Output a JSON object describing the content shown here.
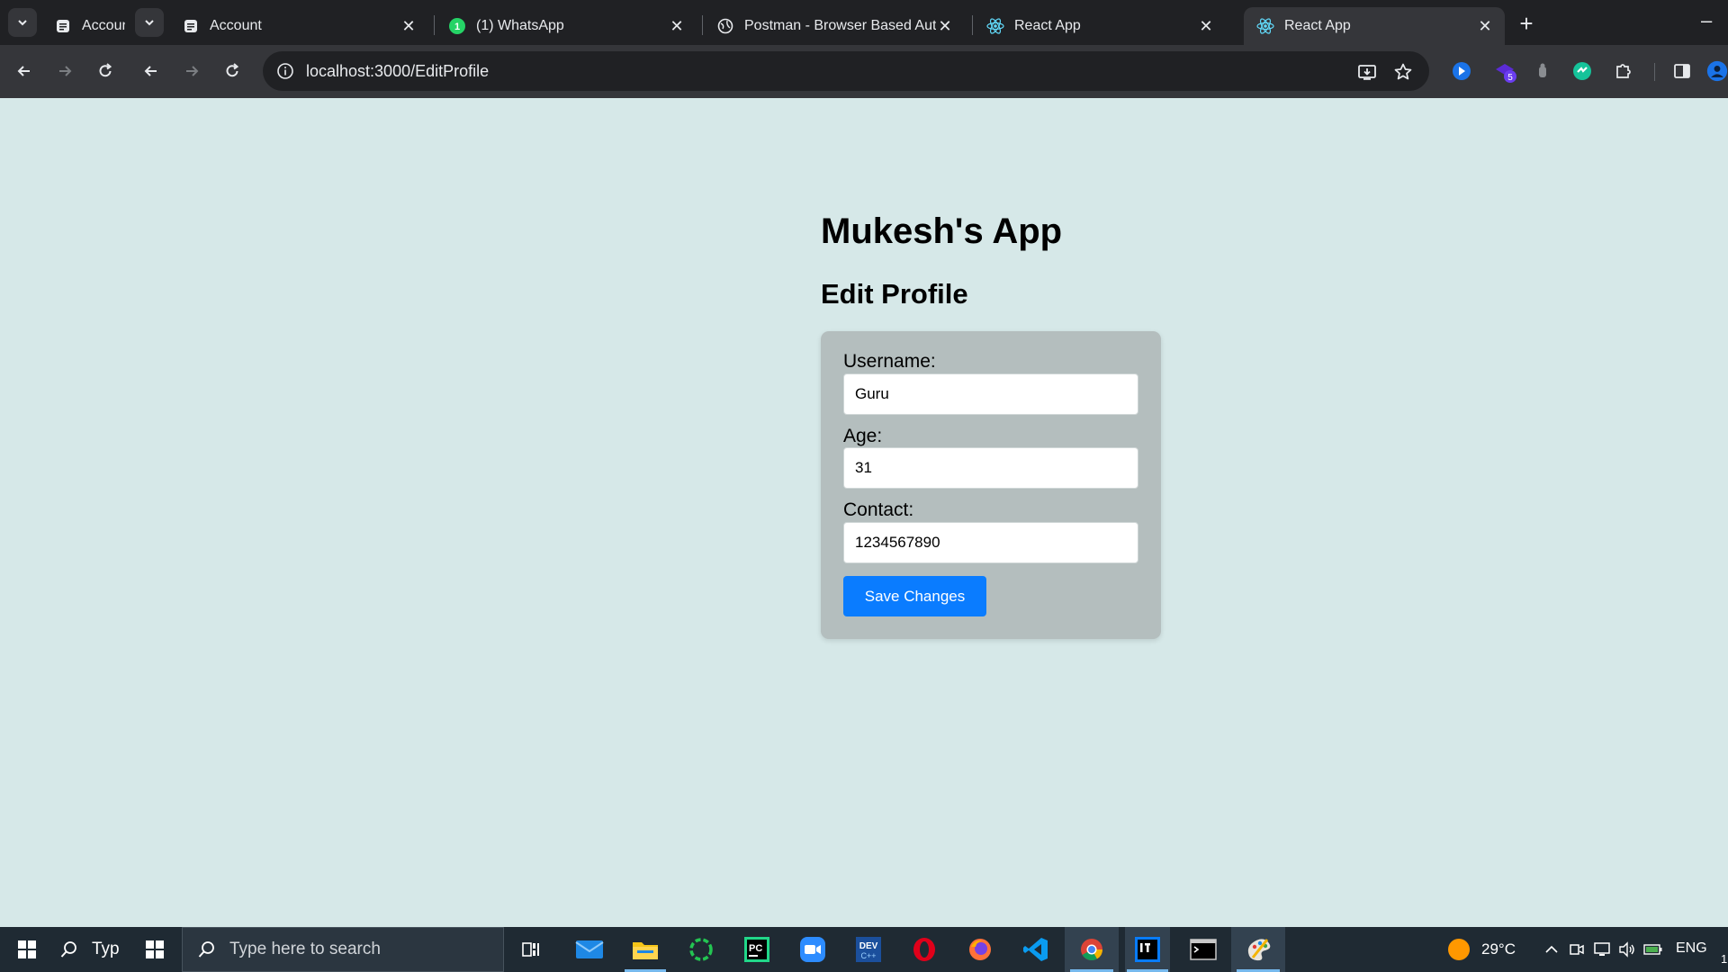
{
  "browser": {
    "tabs": [
      {
        "title": "Accoun",
        "icon": "document-icon"
      },
      {
        "title": "Account",
        "icon": "document-icon"
      },
      {
        "title": "(1) WhatsApp",
        "icon": "whatsapp-icon"
      },
      {
        "title": "Postman - Browser Based Auth",
        "icon": "globe-icon"
      },
      {
        "title": "React App",
        "icon": "react-icon"
      },
      {
        "title": "React App",
        "icon": "react-icon",
        "active": true
      }
    ],
    "url": "localhost:3000/EditProfile",
    "extension_badge": "5"
  },
  "page": {
    "app_title": "Mukesh's App",
    "heading": "Edit Profile",
    "form": {
      "username_label": "Username:",
      "username_value": "Guru",
      "age_label": "Age:",
      "age_value": "31",
      "contact_label": "Contact:",
      "contact_value": "1234567890",
      "save_label": "Save Changes"
    }
  },
  "taskbar": {
    "search_short": "Typ",
    "search_placeholder": "Type here to search",
    "weather": "29°C",
    "language": "ENG",
    "clock_partial": "1"
  },
  "colors": {
    "page_bg": "#d6e8e8",
    "card_bg": "#b4bebe",
    "button": "#0a7cff",
    "taskbar": "#1f2a33",
    "chrome_dark": "#202124",
    "chrome_toolbar": "#35363a"
  }
}
